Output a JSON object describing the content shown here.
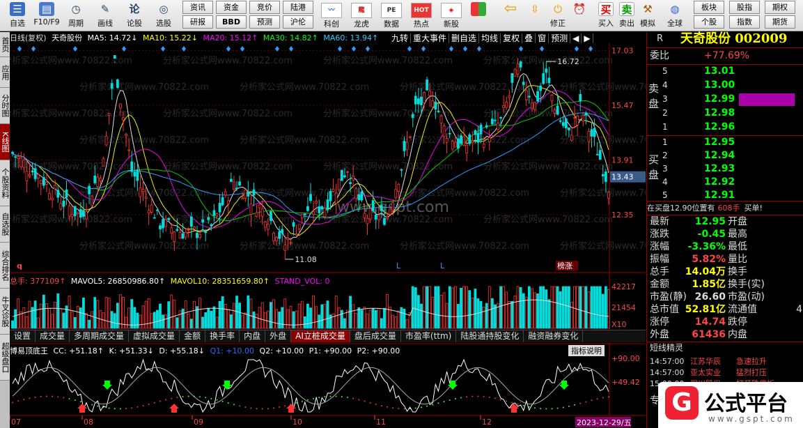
{
  "toolbar": {
    "items": [
      {
        "name": "zixuan",
        "label": "自选",
        "icon": "heart-icon"
      },
      {
        "name": "f10",
        "label": "F10/F9",
        "icon": "document-icon"
      },
      {
        "name": "zhouqi",
        "label": "周期",
        "icon": "clock-icon"
      },
      {
        "name": "huaxian",
        "label": "画线",
        "icon": "pencil-icon"
      },
      {
        "name": "lungu",
        "label": "论股",
        "icon": "chat-icon"
      },
      {
        "name": "xuangu",
        "label": "选股",
        "icon": "target-icon"
      }
    ],
    "small": [
      [
        "资讯",
        "资金",
        "竞价",
        "陆港"
      ],
      [
        "研报",
        "BBD",
        "预测",
        "沪伦"
      ]
    ],
    "icons2": [
      {
        "label": "科创",
        "icon": "kechuang-icon"
      },
      {
        "label": "龙虎",
        "icon": "dragon-icon"
      },
      {
        "label": "数据",
        "icon": "pe-icon",
        "text": "PE"
      },
      {
        "label": "热点",
        "icon": "hot-icon",
        "text": "HOT"
      },
      {
        "label": "新股",
        "icon": "newstock-icon"
      }
    ],
    "icons3": [
      {
        "label": "",
        "icon": "grid-icon"
      },
      {
        "label": "",
        "icon": "left-arrow-icon"
      },
      {
        "label": "",
        "icon": "updown-icon"
      },
      {
        "label": "修正",
        "icon": "power-icon"
      },
      {
        "label": "",
        "icon": "alarm-icon"
      },
      {
        "label": "买入",
        "icon": "buy-icon",
        "text": "买"
      },
      {
        "label": "卖出",
        "icon": "sell-icon",
        "text": "卖"
      },
      {
        "label": "模拟",
        "icon": "hammer-icon"
      },
      {
        "label": "全球",
        "icon": "globe-icon"
      }
    ],
    "rightbtns": [
      [
        "板块",
        "股指",
        "期权"
      ],
      [
        "个股",
        "指数",
        "期货"
      ]
    ]
  },
  "lefttabs": [
    "首页",
    "应用",
    "分时图",
    "K线图",
    "个股资料",
    "自选股",
    "综合排名",
    "牛叉诊股",
    "超级盘口"
  ],
  "header": {
    "period": "日线(复权)",
    "name": "天奇股份",
    "ma5": "MA5: 14.72↓",
    "ma10": "MA10: 15.22↓",
    "ma20": "MA20: 15.12↑",
    "ma30": "MA30: 14.82↑",
    "ma60": "MA60: 13.94↑"
  },
  "toptabs": [
    "九转",
    "重大事件",
    "删自选",
    "均线",
    "复权",
    "叠",
    "窗",
    "预测",
    "◀",
    "▶"
  ],
  "price_axis": [
    "17.03",
    "15.47",
    "13.91",
    "13.43",
    "12.35"
  ],
  "annotations": {
    "high": "16.72",
    "low": "11.08",
    "tag": "榜涨",
    "q": "q",
    "l1": "L",
    "l2": "L"
  },
  "watermark": "分析家公式网www.70822.com",
  "watermark2": "www.gspt.com",
  "volume": {
    "header_total": "总手: 377109↑",
    "mavol5": "MAVOL5: 26850986.80↑",
    "mavol10": "MAVOL10: 28351659.80↑",
    "stand": "STAND_VOL: 0",
    "axis": [
      "42217",
      "21454",
      "X10"
    ]
  },
  "indtabs": [
    "设置",
    "成交量",
    "多周期成交量",
    "虚拟成交量",
    "金额",
    "换手率",
    "内盘",
    "外盘",
    "AI立桩成交量",
    "盘后成交量",
    "市盈率(ttm)",
    "陆股通持股变化",
    "融资融券变化"
  ],
  "indtabs_active": 8,
  "indicator": {
    "name": "博易顶底王",
    "cc": "CC: +51.18↑",
    "k": "K: +51.33↓",
    "d": "D: +55.18↓",
    "q1": "Q1: +10.00",
    "q2": "Q2: +10.00",
    "p1": "P1: +90.00",
    "p2": "P2: +90.00",
    "explain": "指标说明",
    "axis": [
      "+90.00",
      "+49.42"
    ]
  },
  "dates": [
    "07",
    "08",
    "09",
    "10",
    "11",
    "12",
    "2023-12-29/五"
  ],
  "right": {
    "code": "R",
    "title": "天奇股份 002009",
    "weibi_label": "委比",
    "weibi": "+77.69%",
    "sell_label": "卖盘",
    "buy_label": "买盘",
    "sells": [
      [
        "5",
        "13.01"
      ],
      [
        "4",
        "13.00"
      ],
      [
        "3",
        "12.99"
      ],
      [
        "2",
        "12.98"
      ],
      [
        "1",
        "12.96"
      ]
    ],
    "buys": [
      [
        "1",
        "12.95"
      ],
      [
        "2",
        "12.94"
      ],
      [
        "3",
        "12.93"
      ],
      [
        "4",
        "12.92"
      ],
      [
        "5",
        "12.91"
      ]
    ],
    "inbuy": "在买盘12.90位置有",
    "inbuy_qty": "608手",
    "inbuy_tag": "买单!",
    "stats": [
      [
        "最新",
        "12.95",
        "开盘",
        ""
      ],
      [
        "涨跌",
        "-0.45",
        "最高",
        ""
      ],
      [
        "涨幅",
        "-3.36%",
        "最低",
        ""
      ],
      [
        "振幅",
        "5.82%",
        "量比",
        ""
      ],
      [
        "总手",
        "14.04万",
        "换手",
        ""
      ],
      [
        "金额",
        "1.85亿",
        "换手(实)",
        ""
      ],
      [
        "市盈(静)",
        "26.60",
        "市盈(动)",
        ""
      ],
      [
        "总市值",
        "52.81亿",
        "流通值",
        "4"
      ],
      [
        "涨停",
        "14.74",
        "跌停",
        ""
      ],
      [
        "外盘",
        "61436",
        "内盘",
        ""
      ]
    ],
    "short_title": "短线精灵",
    "short": [
      [
        "14:57:00",
        "江苏华辰",
        "急速拉升"
      ],
      [
        "14:57:00",
        "亚太实业",
        "猛烈打压"
      ],
      [
        "15:00:00",
        "司川股份",
        "打开跌停板"
      ]
    ],
    "more": "专"
  },
  "logo": {
    "name": "公式平台",
    "url": "www.gspt.com"
  },
  "chart_data": {
    "type": "candlestick",
    "price_range": [
      10.8,
      17.2
    ],
    "high": 16.72,
    "low": 11.08
  }
}
